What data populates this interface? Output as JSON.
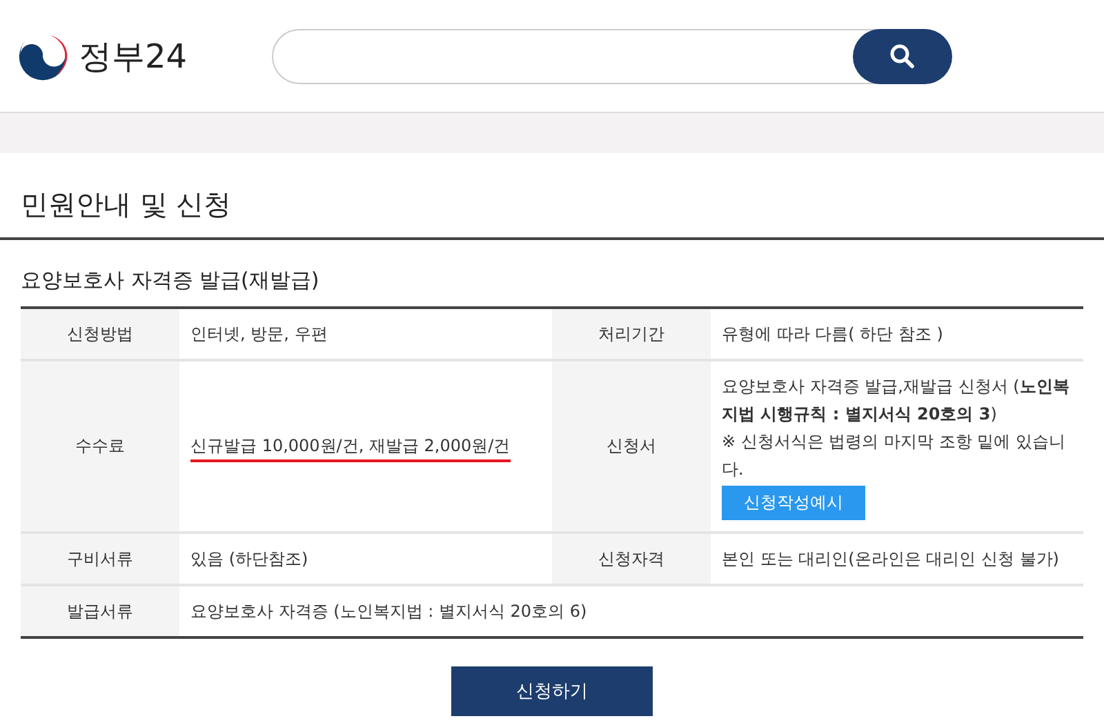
{
  "header": {
    "logo_text": "정부24"
  },
  "page_title": "민원안내 및 신청",
  "section_title": "요양보호사 자격증 발급(재발급)",
  "table": {
    "rows": [
      {
        "cells": [
          {
            "label": "신청방법",
            "value": "인터넷, 방문, 우편"
          },
          {
            "label": "처리기간",
            "value": "유형에 따라 다름( 하단 참조 )"
          }
        ]
      },
      {
        "cells": [
          {
            "label": "수수료",
            "value": "신규발급 10,000원/건, 재발급 2,000원/건",
            "highlighted": true
          },
          {
            "label": "신청서",
            "value": "요양보호사 자격증 발급,재발급 신청서 (**노인복지법 시행규칙 : 별지서식 20호의 3**)",
            "note": "※ 신청서식은 법령의 마지막 조항 밑에 있습니다.",
            "button": "신청작성예시"
          }
        ]
      },
      {
        "cells": [
          {
            "label": "구비서류",
            "value": "있음 (하단참조)"
          },
          {
            "label": "신청자격",
            "value": "본인 또는 대리인(온라인은 대리인 신청 불가)"
          }
        ]
      },
      {
        "cells": [
          {
            "label": "발급서류",
            "value": "요양보호사 자격증 (노인복지법 : 별지서식 20호의 6)"
          }
        ]
      }
    ]
  },
  "apply_button": "신청하기"
}
